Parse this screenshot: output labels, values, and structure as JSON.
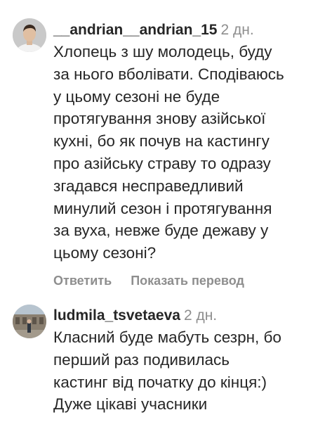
{
  "comments": [
    {
      "username": "__andrian__andrian_15",
      "time": "2 дн.",
      "text": "Хлопець з шу молодець, буду\nза нього вболівати. Сподіваюсь\nу цьому сезоні не буде\nпротягування знову азійської\nкухні, бо як почув на кастингу\nпро азійську страву то одразу\nзгадався несправедливий\nминулий сезон і протягування\nза вуха, невже буде дежаву у\nцьому сезоні?",
      "reply_label": "Ответить",
      "translate_label": "Показать перевод"
    },
    {
      "username": "ludmila_tsvetaeva",
      "time": "2 дн.",
      "text": "Класний буде мабуть сезрн, бо\nперший раз подивилась\nкастинг від початку  до кінця:)\nДуже цікаві учасники"
    }
  ]
}
